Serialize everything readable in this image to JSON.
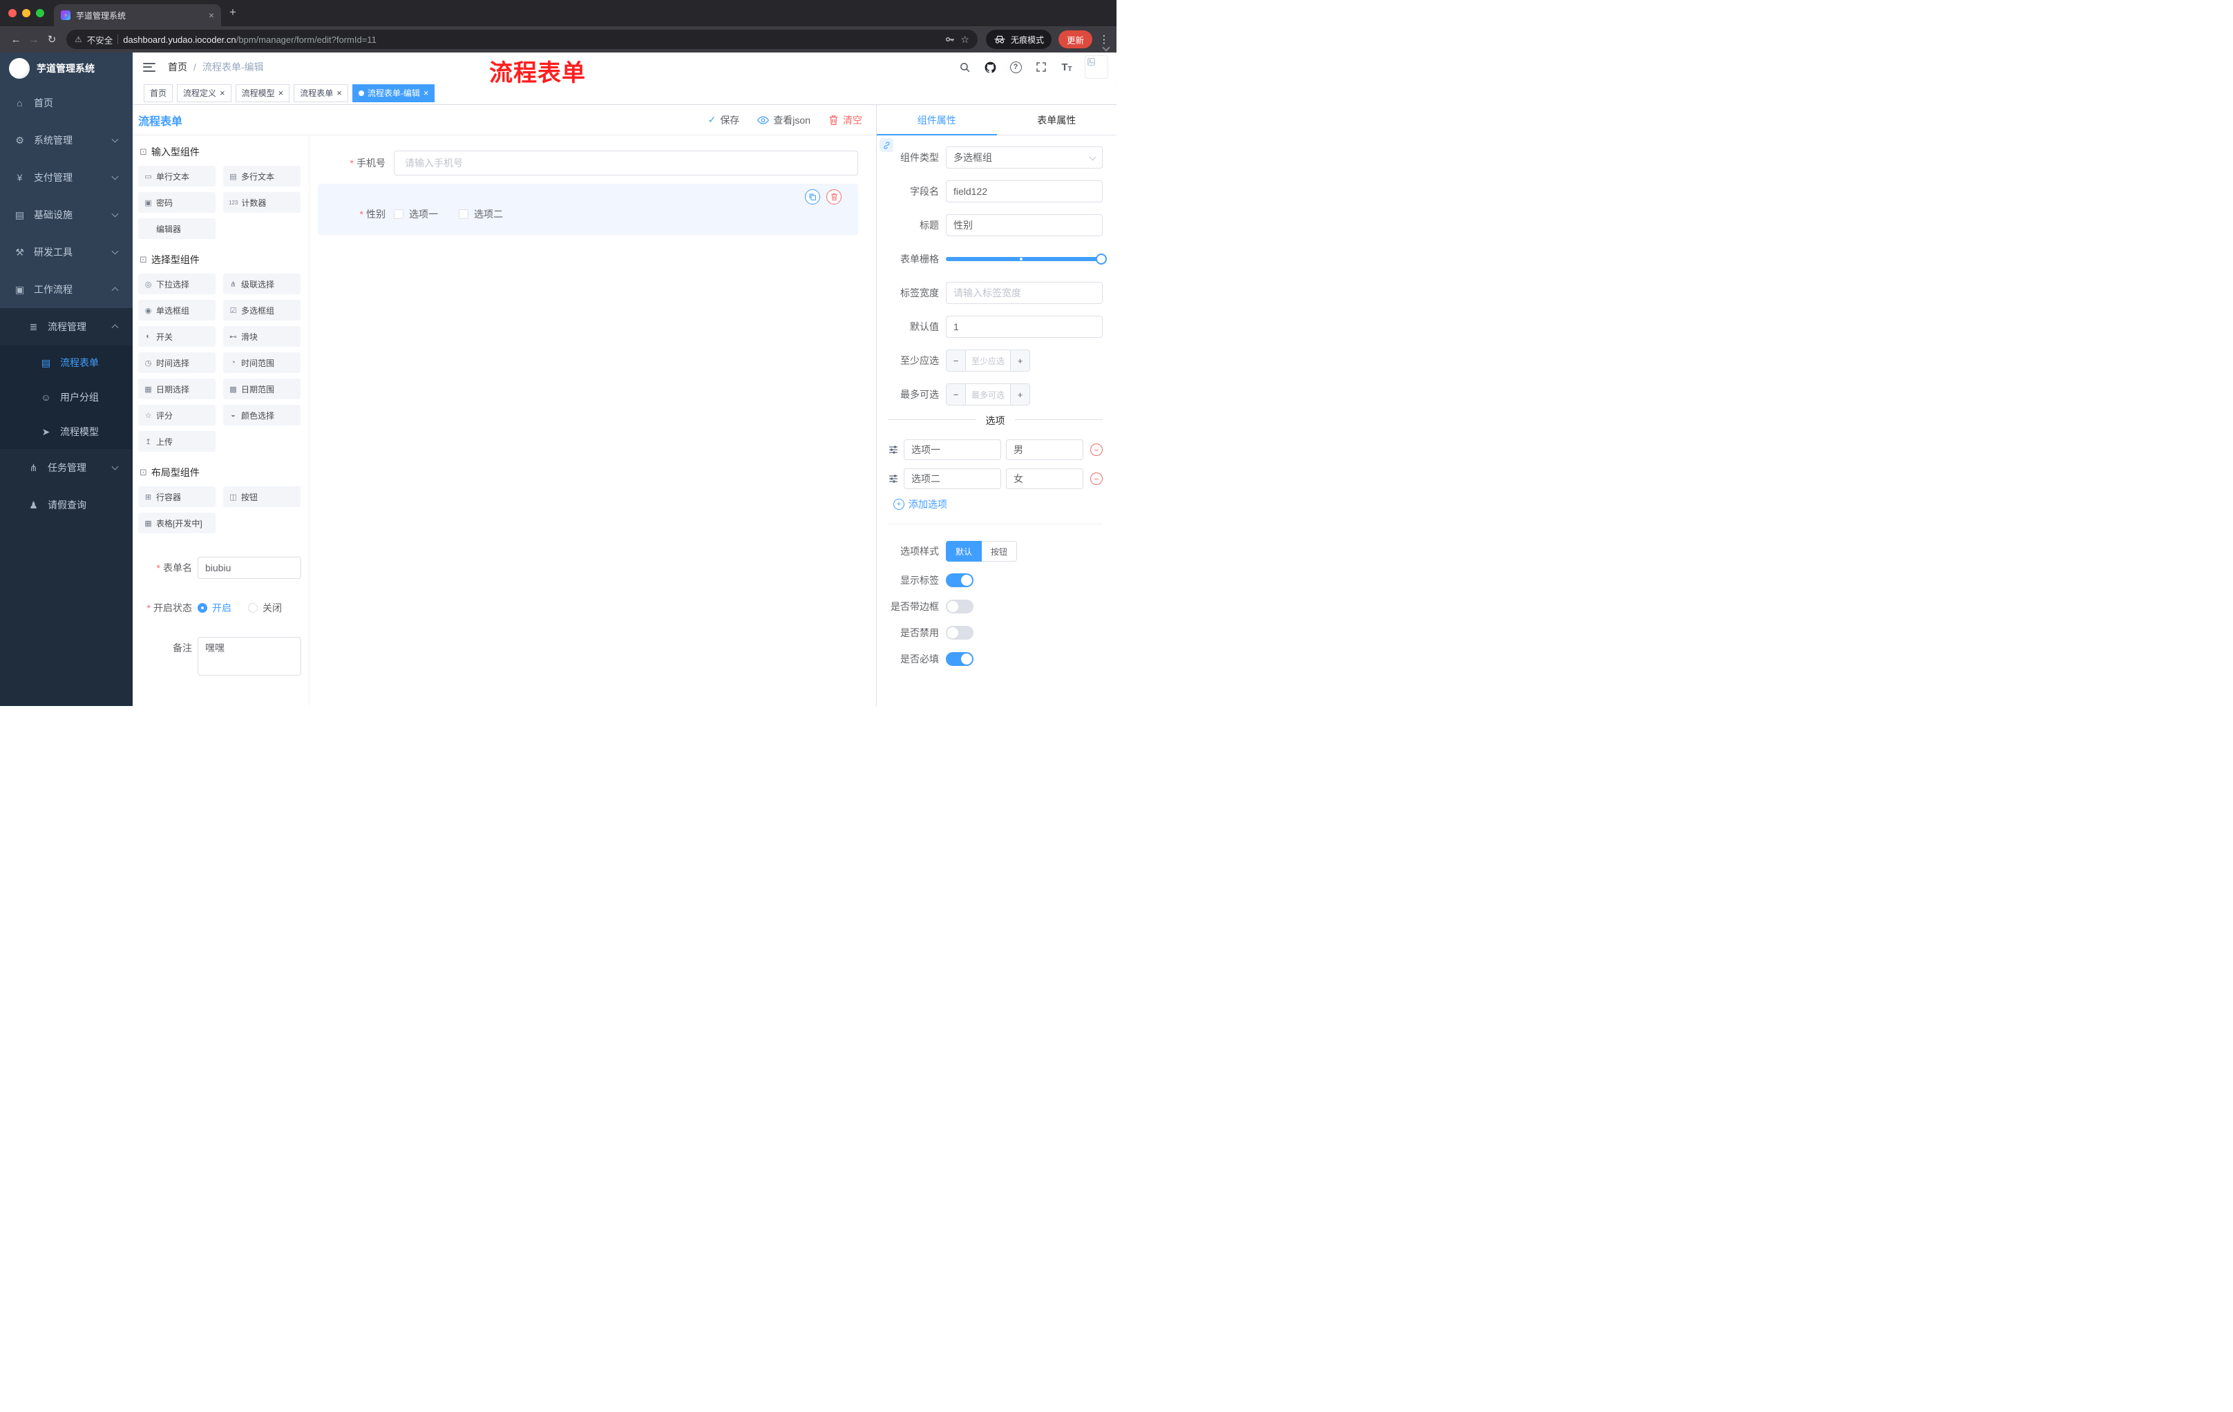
{
  "colors": {
    "accent": "#409eff",
    "danger": "#f56c6c",
    "annotation_red": "#ff1e1e",
    "sidebar_base": "#304156",
    "sidebar_submenu": "#1f2d3d",
    "update_chip": "#dd4b3e"
  },
  "browser": {
    "tab_title": "芋道管理系统",
    "security_label": "不安全",
    "url_host": "dashboard.yudao.iocoder.cn",
    "url_path": "/bpm/manager/form/edit?formId=11",
    "incognito_label": "无痕模式",
    "update_label": "更新"
  },
  "icons": {
    "bolt": "⚡",
    "close": "×",
    "new_tab": "+",
    "back": "←",
    "forward": "→",
    "reload": "↻",
    "warning": "⚠",
    "star": "☆",
    "kebab": "⋮",
    "help": "?",
    "font_large": "T",
    "font_small": "T",
    "save_check": "✓",
    "minus": "−",
    "plus": "+",
    "breadcrumb_sep": "/"
  },
  "annotation": {
    "text": "流程表单"
  },
  "sidebar": {
    "logo_title": "芋道管理系统",
    "items": [
      {
        "label": "首页",
        "icon": "⌂"
      },
      {
        "label": "系统管理",
        "icon": "⚙"
      },
      {
        "label": "支付管理",
        "icon": "¥"
      },
      {
        "label": "基础设施",
        "icon": "▤"
      },
      {
        "label": "研发工具",
        "icon": "⚒"
      },
      {
        "label": "工作流程",
        "icon": "▣"
      },
      {
        "label": "流程管理",
        "icon": "≣"
      },
      {
        "label": "流程表单",
        "icon": "▤"
      },
      {
        "label": "用户分组",
        "icon": "☺"
      },
      {
        "label": "流程模型",
        "icon": "➤"
      },
      {
        "label": "任务管理",
        "icon": "⋔"
      },
      {
        "label": "请假查询",
        "icon": "♟"
      }
    ]
  },
  "breadcrumb": {
    "home": "首页",
    "current": "流程表单-编辑"
  },
  "tags": [
    {
      "label": "首页"
    },
    {
      "label": "流程定义"
    },
    {
      "label": "流程模型"
    },
    {
      "label": "流程表单"
    },
    {
      "label": "流程表单-编辑"
    }
  ],
  "designer": {
    "title": "流程表单",
    "save": "保存",
    "view_json": "查看json",
    "clear": "清空"
  },
  "palette": {
    "sections": [
      {
        "icon": "⊡",
        "title": "输入型组件",
        "items": [
          {
            "icon": "▭",
            "label": "单行文本"
          },
          {
            "icon": "▤",
            "label": "多行文本"
          },
          {
            "icon": "▣",
            "label": "密码"
          },
          {
            "icon": "123",
            "label": "计数器"
          },
          {
            "icon": "",
            "label": "编辑器"
          }
        ]
      },
      {
        "icon": "⊡",
        "title": "选择型组件",
        "items": [
          {
            "icon": "◎",
            "label": "下拉选择"
          },
          {
            "icon": "⋔",
            "label": "级联选择"
          },
          {
            "icon": "◉",
            "label": "单选框组"
          },
          {
            "icon": "☑",
            "label": "多选框组"
          },
          {
            "icon": "◐",
            "label": "开关"
          },
          {
            "icon": "⊷",
            "label": "滑块"
          },
          {
            "icon": "◷",
            "label": "时间选择"
          },
          {
            "icon": "◔",
            "label": "时间范围"
          },
          {
            "icon": "▦",
            "label": "日期选择"
          },
          {
            "icon": "▩",
            "label": "日期范围"
          },
          {
            "icon": "☆",
            "label": "评分"
          },
          {
            "icon": "◒",
            "label": "颜色选择"
          },
          {
            "icon": "↥",
            "label": "上传"
          }
        ]
      },
      {
        "icon": "⊡",
        "title": "布局型组件",
        "items": [
          {
            "icon": "⊞",
            "label": "行容器"
          },
          {
            "icon": "◫",
            "label": "按钮"
          },
          {
            "icon": "▦",
            "label": "表格[开发中]"
          }
        ]
      }
    ],
    "form": {
      "name_label": "表单名",
      "name_value": "biubiu",
      "status_label": "开启状态",
      "status_on": "开启",
      "status_off": "关闭",
      "remark_label": "备注",
      "remark_value": "嘿嘿"
    }
  },
  "canvas": {
    "phone_label": "手机号",
    "phone_placeholder": "请输入手机号",
    "gender_label": "性别",
    "gender_option1": "选项一",
    "gender_option2": "选项二"
  },
  "props": {
    "tab_component": "组件属性",
    "tab_form": "表单属性",
    "component_type_label": "组件类型",
    "component_type_value": "多选框组",
    "field_name_label": "字段名",
    "field_name_value": "field122",
    "title_label": "标题",
    "title_value": "性别",
    "grid_label": "表单栅格",
    "label_width_label": "标签宽度",
    "label_width_placeholder": "请输入标签宽度",
    "default_label": "默认值",
    "default_value": "1",
    "min_label": "至少应选",
    "min_placeholder": "至少应选",
    "max_label": "最多可选",
    "max_placeholder": "最多可选",
    "options_title": "选项",
    "options": [
      {
        "label": "选项一",
        "value": "男"
      },
      {
        "label": "选项二",
        "value": "女"
      }
    ],
    "add_option": "添加选项",
    "style_label": "选项样式",
    "style_default": "默认",
    "style_button": "按钮",
    "switch_show_label": "显示标签",
    "switch_border": "是否带边框",
    "switch_disabled": "是否禁用",
    "switch_required": "是否必填"
  }
}
